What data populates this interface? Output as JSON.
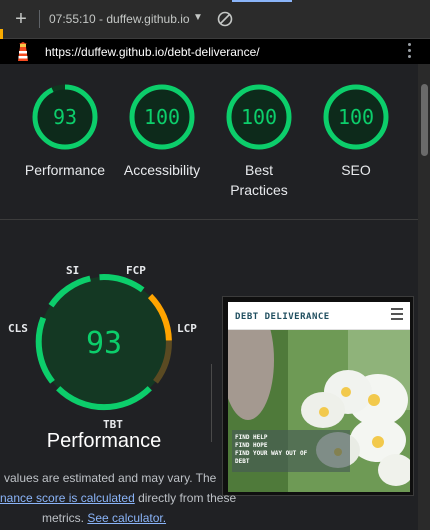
{
  "toolbar": {
    "plus_icon": "plus-icon",
    "timestamp_url": "07:55:10 - duffew.github.io",
    "dropdown_icon": "caret-down-icon",
    "block_icon": "no-entry-icon"
  },
  "address": {
    "url": "https://duffew.github.io/debt-deliverance/",
    "menu_icon": "more-vert-icon",
    "lighthouse_icon": "lighthouse-icon"
  },
  "categories": [
    {
      "score": "93",
      "label": "Performance",
      "fraction": 0.93
    },
    {
      "score": "100",
      "label": "Accessibility",
      "fraction": 1.0
    },
    {
      "score": "100",
      "label": "Best Practices",
      "fraction": 1.0
    },
    {
      "score": "100",
      "label": "SEO",
      "fraction": 1.0
    }
  ],
  "performance": {
    "score": "93",
    "title": "Performance",
    "metrics": [
      "SI",
      "FCP",
      "LCP",
      "TBT",
      "CLS"
    ],
    "colors": {
      "pass": "#0cce6b",
      "average": "#ffa400"
    }
  },
  "note": {
    "line1": "values are estimated and may vary. The",
    "link1": "nance score is calculated",
    "line2_rest": "directly from these",
    "line3_lead": "metrics.",
    "link2": "See calculator."
  },
  "preview": {
    "site_title": "DEBT DELIVERANCE",
    "menu_icon": "hamburger-menu-icon",
    "taglines": [
      "FIND HELP",
      "FIND HOPE",
      "FIND YOUR WAY OUT OF",
      "DEBT"
    ]
  }
}
